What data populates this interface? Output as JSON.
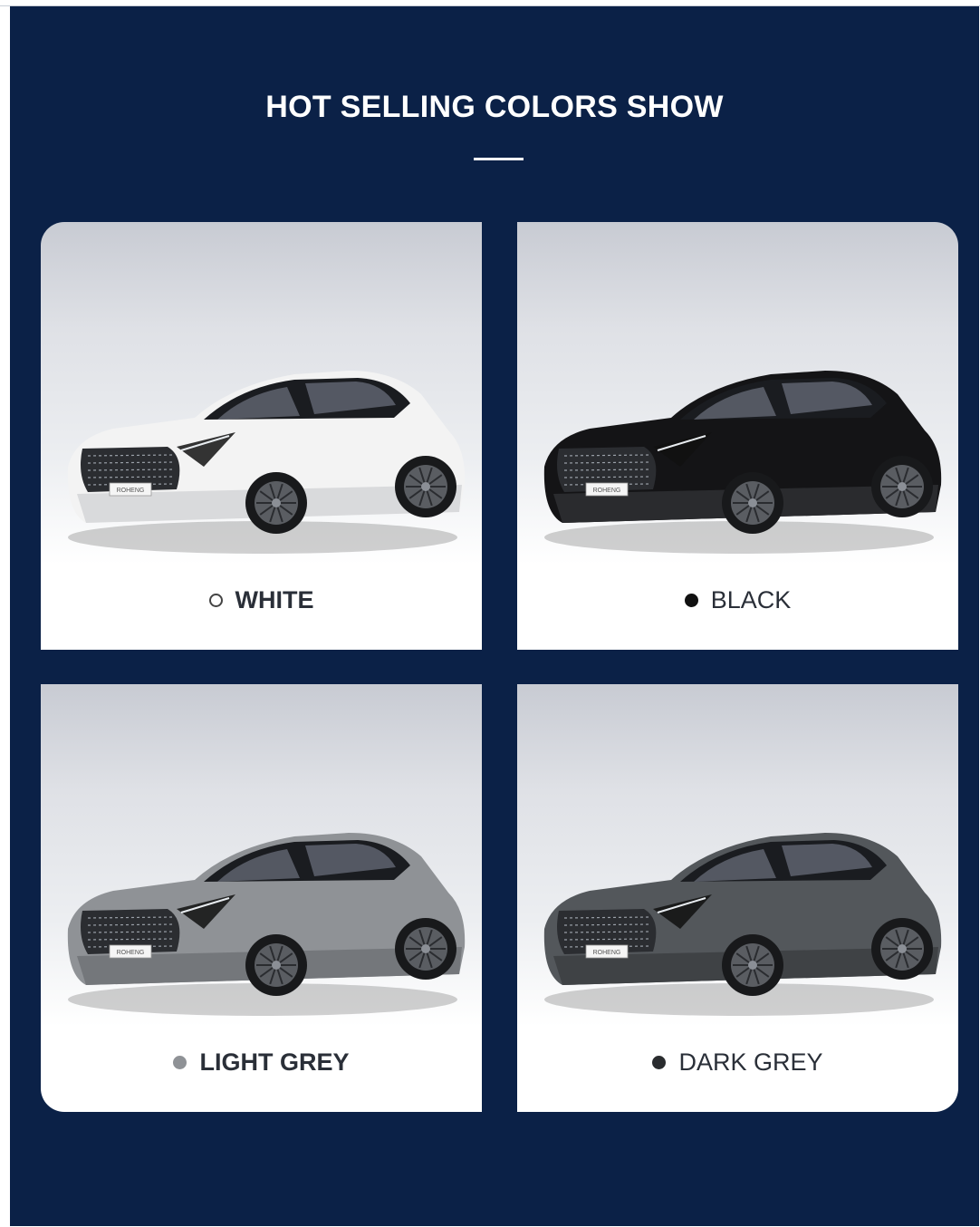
{
  "header": {
    "title": "HOT SELLING COLORS SHOW"
  },
  "colors": [
    {
      "name": "WHITE",
      "body": "#f3f3f3",
      "shade": "#d9dadc",
      "dot": "#ffffff",
      "dot_border": "#444444",
      "bold": true
    },
    {
      "name": "BLACK",
      "body": "#141416",
      "shade": "#2a2b2e",
      "dot": "#111111",
      "dot_border": "#111111",
      "bold": false
    },
    {
      "name": "LIGHT GREY",
      "body": "#8f9296",
      "shade": "#74777b",
      "dot": "#8f9296",
      "dot_border": "#8f9296",
      "bold": true
    },
    {
      "name": "DARK GREY",
      "body": "#53575b",
      "shade": "#3f4245",
      "dot": "#2a2c2f",
      "dot_border": "#2a2c2f",
      "bold": false
    }
  ],
  "car_badge": "ROHENG"
}
